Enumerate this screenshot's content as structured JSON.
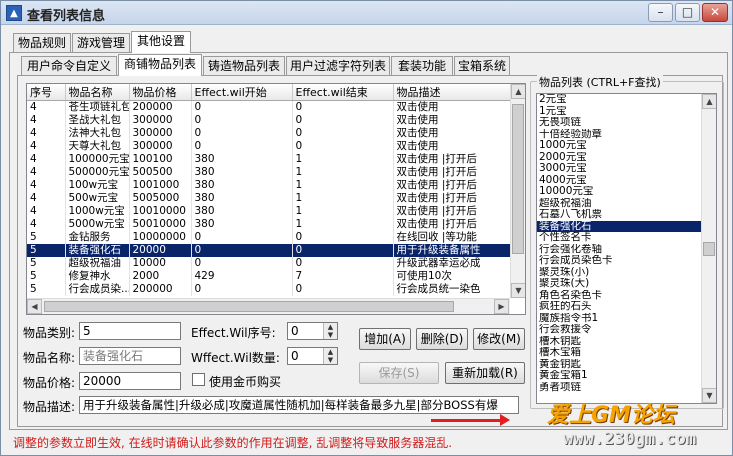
{
  "window": {
    "title": "查看列表信息",
    "app_icon": "app-icon"
  },
  "main_tabs": [
    {
      "label": "物品规则"
    },
    {
      "label": "游戏管理"
    },
    {
      "label": "其他设置"
    }
  ],
  "sub_tabs": [
    {
      "label": "用户命令自定义"
    },
    {
      "label": "商铺物品列表"
    },
    {
      "label": "铸造物品列表"
    },
    {
      "label": "用户过滤字符列表"
    },
    {
      "label": "套装功能"
    },
    {
      "label": "宝箱系统"
    }
  ],
  "table": {
    "columns": [
      "序号",
      "物品名称",
      "物品价格",
      "Effect.wil开始",
      "Effect.wil结束",
      "物品描述"
    ],
    "rows": [
      [
        "4",
        "苍生项链礼包",
        "200000",
        "0",
        "0",
        "双击使用"
      ],
      [
        "4",
        "圣战大礼包",
        "300000",
        "0",
        "0",
        "双击使用"
      ],
      [
        "4",
        "法神大礼包",
        "300000",
        "0",
        "0",
        "双击使用"
      ],
      [
        "4",
        "天尊大礼包",
        "300000",
        "0",
        "0",
        "双击使用"
      ],
      [
        "4",
        "100000元宝",
        "100100",
        "380",
        "1",
        "双击使用 |打开后"
      ],
      [
        "4",
        "500000元宝",
        "500500",
        "380",
        "1",
        "双击使用 |打开后"
      ],
      [
        "4",
        "100w元宝",
        "1001000",
        "380",
        "1",
        "双击使用 |打开后"
      ],
      [
        "4",
        "500w元宝",
        "5005000",
        "380",
        "1",
        "双击使用 |打开后"
      ],
      [
        "4",
        "1000w元宝",
        "10010000",
        "380",
        "1",
        "双击使用 |打开后"
      ],
      [
        "4",
        "5000w元宝",
        "50010000",
        "380",
        "1",
        "双击使用 |打开后"
      ],
      [
        "5",
        "金钻服务",
        "10000000",
        "0",
        "0",
        "在线回收 |等功能"
      ],
      [
        "5",
        "装备强化石",
        "20000",
        "0",
        "0",
        "用于升级装备属性"
      ],
      [
        "5",
        "超级祝福油",
        "10000",
        "0",
        "0",
        "升级武器幸运必成"
      ],
      [
        "5",
        "修复神水",
        "2000",
        "429",
        "7",
        "可使用10次"
      ],
      [
        "5",
        "行会成员染...",
        "200000",
        "0",
        "0",
        "行会成员统一染色"
      ]
    ],
    "selected_row": 11
  },
  "form": {
    "category_label": "物品类别:",
    "category_value": "5",
    "name_label": "物品名称:",
    "name_value": "装备强化石",
    "price_label": "物品价格:",
    "price_value": "20000",
    "effect_index_label": "Effect.Wil序号:",
    "effect_index_value": "0",
    "effect_count_label": "Wffect.Wil数量:",
    "effect_count_value": "0",
    "gold_checkbox_label": "使用金币购买",
    "gold_checked": false,
    "desc_label": "物品描述:",
    "desc_value": "用于升级装备属性|升级必成|攻魔道属性随机加|每样装备最多九星|部分BOSS有爆"
  },
  "buttons": {
    "add": "增加(A)",
    "delete": "删除(D)",
    "modify": "修改(M)",
    "save": "保存(S)",
    "reload": "重新加载(R)"
  },
  "item_list": {
    "title": "物品列表 (CTRL+F查找)",
    "items": [
      "2元宝",
      "1元宝",
      "无畏项链",
      "十倍经验勋章",
      "1000元宝",
      "2000元宝",
      "3000元宝",
      "4000元宝",
      "10000元宝",
      "超级祝福油",
      "石墓八飞机票",
      "装备强化石",
      "个性签名卡",
      "行会强化卷轴",
      "行会成员染色卡",
      "聚灵珠(小)",
      "聚灵珠(大)",
      "角色名染色卡",
      "疯狂的石头",
      "魔族指令书1",
      "行会救援令",
      "槽木钥匙",
      "槽木宝箱",
      "黄金钥匙",
      "黄金宝箱1",
      "勇者项链"
    ],
    "selected_index": 11,
    "scroll_fraction": 0.5
  },
  "warning": "调整的参数立即生效, 在线时请确认此参数的作用在调整, 乱调整将导致服务器混乱.",
  "watermark": {
    "line1": "爱上GM论坛",
    "line2": "www.230gm.com"
  },
  "colors": {
    "selection": "#0a246a",
    "warning": "#d11a1a",
    "watermark": "#f5a300"
  }
}
